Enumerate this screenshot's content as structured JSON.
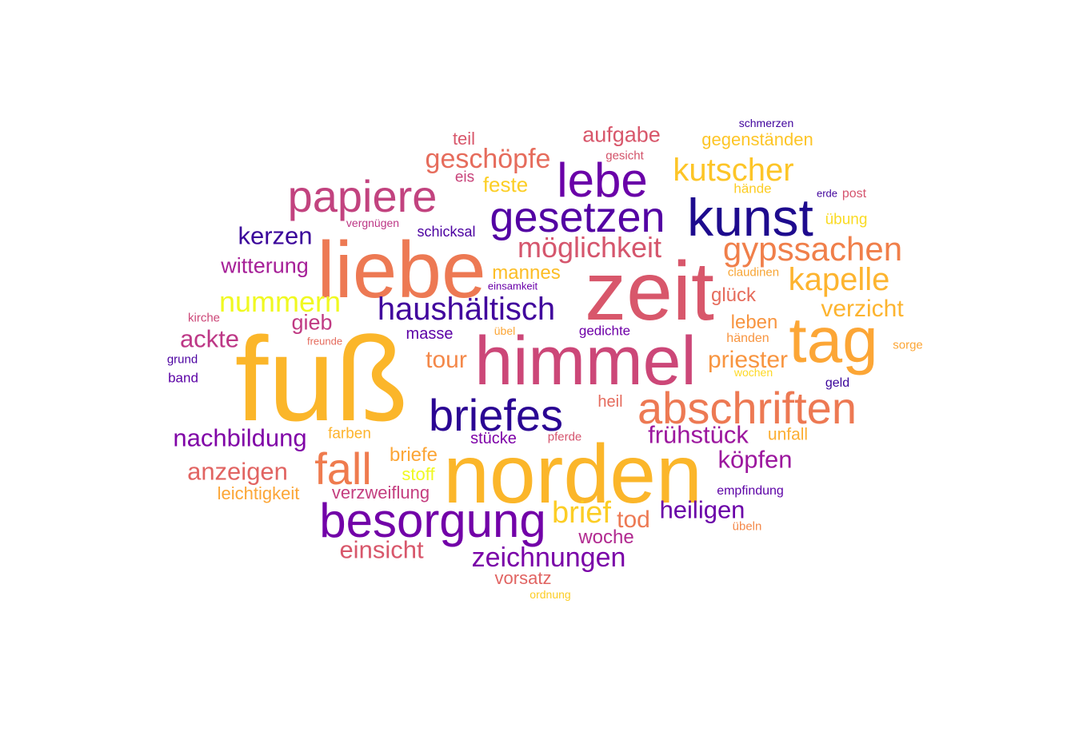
{
  "words": [
    {
      "text": "fuß",
      "color": "#fbb62a"
    },
    {
      "text": "norden",
      "color": "#fbb62a"
    },
    {
      "text": "zeit",
      "color": "#d8576b"
    },
    {
      "text": "himmel",
      "color": "#cc4778"
    },
    {
      "text": "liebe",
      "color": "#ed7953"
    },
    {
      "text": "tag",
      "color": "#fca636"
    },
    {
      "text": "kunst",
      "color": "#1e0b8e"
    },
    {
      "text": "abschriften",
      "color": "#ed7953"
    },
    {
      "text": "briefes",
      "color": "#2a0593"
    },
    {
      "text": "besorgung",
      "color": "#7201a8"
    },
    {
      "text": "papiere",
      "color": "#c2437f"
    },
    {
      "text": "gesetzen",
      "color": "#5302a3"
    },
    {
      "text": "lebe",
      "color": "#6a00a8"
    },
    {
      "text": "fall",
      "color": "#ef7b4e"
    },
    {
      "text": "gypssachen",
      "color": "#f07f4a"
    },
    {
      "text": "haushältisch",
      "color": "#41049d"
    },
    {
      "text": "kutscher",
      "color": "#fdc527"
    },
    {
      "text": "kapelle",
      "color": "#fdb42f"
    },
    {
      "text": "möglichkeit",
      "color": "#d5566d"
    },
    {
      "text": "nummern",
      "color": "#f0f921"
    },
    {
      "text": "geschöpfe",
      "color": "#e66c5c"
    },
    {
      "text": "zeichnungen",
      "color": "#7a02a8"
    },
    {
      "text": "brief",
      "color": "#fccd25"
    },
    {
      "text": "nachbildung",
      "color": "#8004a7"
    },
    {
      "text": "frühstück",
      "color": "#9c179e"
    },
    {
      "text": "einsicht",
      "color": "#d8576b"
    },
    {
      "text": "heiligen",
      "color": "#6a00a8"
    },
    {
      "text": "anzeigen",
      "color": "#e16462"
    },
    {
      "text": "kerzen",
      "color": "#3a049a"
    },
    {
      "text": "köpfen",
      "color": "#9c179e"
    },
    {
      "text": "witterung",
      "color": "#a62098"
    },
    {
      "text": "verzicht",
      "color": "#fdb42f"
    },
    {
      "text": "ackte",
      "color": "#bd3786"
    },
    {
      "text": "aufgabe",
      "color": "#d8576b"
    },
    {
      "text": "tour",
      "color": "#f48849"
    },
    {
      "text": "tod",
      "color": "#ed7953"
    },
    {
      "text": "priester",
      "color": "#f89540"
    },
    {
      "text": "woche",
      "color": "#b12a90"
    },
    {
      "text": "gieb",
      "color": "#c03a83"
    },
    {
      "text": "mannes",
      "color": "#fcbd25"
    },
    {
      "text": "glück",
      "color": "#e66c5c"
    },
    {
      "text": "leben",
      "color": "#f89540"
    },
    {
      "text": "verzweiflung",
      "color": "#c43e7f"
    },
    {
      "text": "briefe",
      "color": "#fca636"
    },
    {
      "text": "feste",
      "color": "#fcce25"
    },
    {
      "text": "vorsatz",
      "color": "#e16462"
    },
    {
      "text": "gegenständen",
      "color": "#fdc527"
    },
    {
      "text": "leichtigkeit",
      "color": "#fca636"
    },
    {
      "text": "stoff",
      "color": "#f0f921"
    },
    {
      "text": "masse",
      "color": "#5c01a6"
    },
    {
      "text": "stücke",
      "color": "#7e03a8"
    },
    {
      "text": "teil",
      "color": "#d8576b"
    },
    {
      "text": "farben",
      "color": "#fdb42f"
    },
    {
      "text": "unfall",
      "color": "#fcae33"
    },
    {
      "text": "heil",
      "color": "#e56b5d"
    },
    {
      "text": "schicksal",
      "color": "#4c02a1"
    },
    {
      "text": "eis",
      "color": "#c8437a"
    },
    {
      "text": "übung",
      "color": "#fadb24"
    },
    {
      "text": "gedichte",
      "color": "#6e00a8"
    },
    {
      "text": "empfindung",
      "color": "#5c01a6"
    },
    {
      "text": "geld",
      "color": "#3a049a"
    },
    {
      "text": "händen",
      "color": "#f89540"
    },
    {
      "text": "hände",
      "color": "#fccd25"
    },
    {
      "text": "post",
      "color": "#d5546e"
    },
    {
      "text": "schmerzen",
      "color": "#41049d"
    },
    {
      "text": "gesicht",
      "color": "#d25269"
    },
    {
      "text": "band",
      "color": "#5a01a5"
    },
    {
      "text": "grund",
      "color": "#4c02a1"
    },
    {
      "text": "kirche",
      "color": "#cc4778"
    },
    {
      "text": "freunde",
      "color": "#e56b5d"
    },
    {
      "text": "vergnügen",
      "color": "#bd3786"
    },
    {
      "text": "claudinen",
      "color": "#f7a535"
    },
    {
      "text": "einsamkeit",
      "color": "#6a00a8"
    },
    {
      "text": "übel",
      "color": "#fca636"
    },
    {
      "text": "pferde",
      "color": "#d5546e"
    },
    {
      "text": "erde",
      "color": "#41049d"
    },
    {
      "text": "sorge",
      "color": "#fca636"
    },
    {
      "text": "wochen",
      "color": "#fdd825"
    },
    {
      "text": "übeln",
      "color": "#f48849"
    },
    {
      "text": "ordnung",
      "color": "#fccd25"
    }
  ]
}
